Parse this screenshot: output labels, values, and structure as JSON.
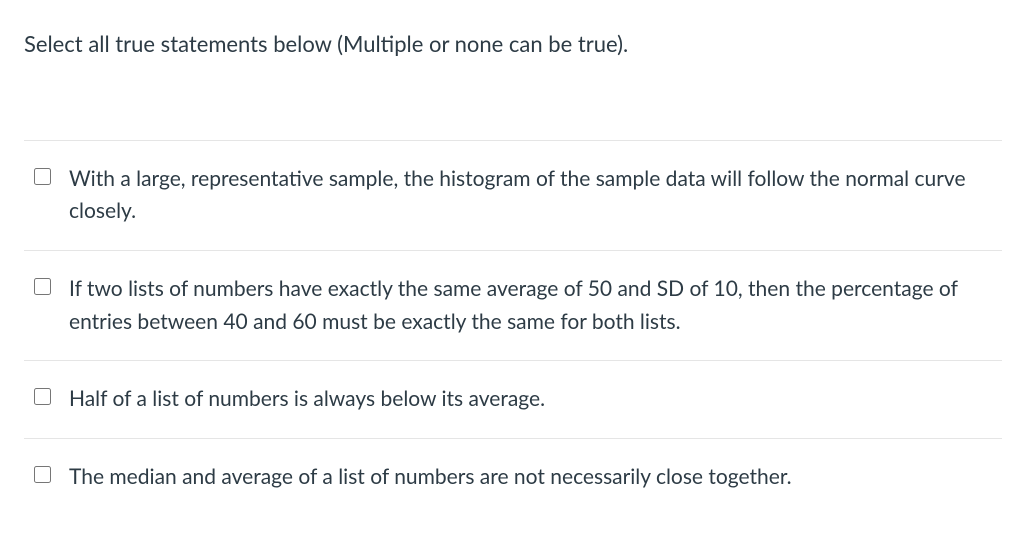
{
  "question": {
    "prompt": "Select all true statements below (Multiple or none can be true)."
  },
  "options": [
    {
      "label": "With a large, representative sample, the histogram of the sample data will follow the normal curve closely."
    },
    {
      "label": "If two lists of numbers have exactly the same average of 50 and SD of 10, then the percentage of entries between 40 and 60 must be exactly the same for both lists."
    },
    {
      "label": "Half of a list of numbers is always below its average."
    },
    {
      "label": "The median and average of a list of numbers are not necessarily close together."
    }
  ]
}
